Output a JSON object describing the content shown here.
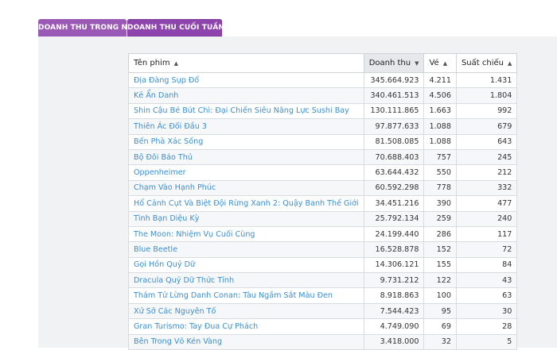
{
  "tabs": [
    {
      "label": "DOANH THU TRONG NGÀY"
    },
    {
      "label": "DOANH THU CUỐI TUẦN"
    }
  ],
  "table": {
    "columns": [
      {
        "label": "Tên phim",
        "sort": "▲"
      },
      {
        "label": "Doanh thu",
        "sort": "▼"
      },
      {
        "label": "Vé",
        "sort": "▲"
      },
      {
        "label": "Suất chiếu",
        "sort": "▲"
      }
    ],
    "rows": [
      [
        "Địa Đàng Sụp Đổ",
        "345.664.923",
        "4.211",
        "1.431"
      ],
      [
        "Kẻ Ẩn Danh",
        "340.461.513",
        "4.506",
        "1.804"
      ],
      [
        "Shin Cậu Bé Bút Chì: Đại Chiến Siêu Năng Lực Sushi Bay",
        "130.111.865",
        "1.663",
        "992"
      ],
      [
        "Thiên Ác Đối Đầu 3",
        "97.877.633",
        "1.088",
        "679"
      ],
      [
        "Bến Phà Xác Sống",
        "81.508.085",
        "1.088",
        "643"
      ],
      [
        "Bộ Đôi Báo Thủ",
        "70.688.403",
        "757",
        "245"
      ],
      [
        "Oppenheimer",
        "63.644.432",
        "550",
        "212"
      ],
      [
        "Chạm Vào Hạnh Phúc",
        "60.592.298",
        "778",
        "332"
      ],
      [
        "Hổ Cảnh Cụt Và Biệt Đội Rừng Xanh 2: Quậy Banh Thế Giới",
        "34.451.216",
        "390",
        "477"
      ],
      [
        "Tình Bạn Diệu Kỳ",
        "25.792.134",
        "259",
        "240"
      ],
      [
        "The Moon: Nhiệm Vụ Cuối Cùng",
        "24.199.440",
        "286",
        "117"
      ],
      [
        "Blue Beetle",
        "16.528.878",
        "152",
        "72"
      ],
      [
        "Gọi Hồn Quỷ Dữ",
        "14.306.121",
        "155",
        "84"
      ],
      [
        "Dracula Quỷ Dữ Thức Tỉnh",
        "9.731.212",
        "122",
        "43"
      ],
      [
        "Thám Tử Lừng Danh Conan: Tàu Ngầm Sắt Màu Đen",
        "8.918.863",
        "100",
        "63"
      ],
      [
        "Xứ Sở Các Nguyên Tố",
        "7.544.423",
        "95",
        "30"
      ],
      [
        "Gran Turismo: Tay Đua Cự Phách",
        "4.749.090",
        "69",
        "28"
      ],
      [
        "Bên Trong Vỏ Kén Vàng",
        "3.418.000",
        "32",
        "5"
      ]
    ]
  }
}
